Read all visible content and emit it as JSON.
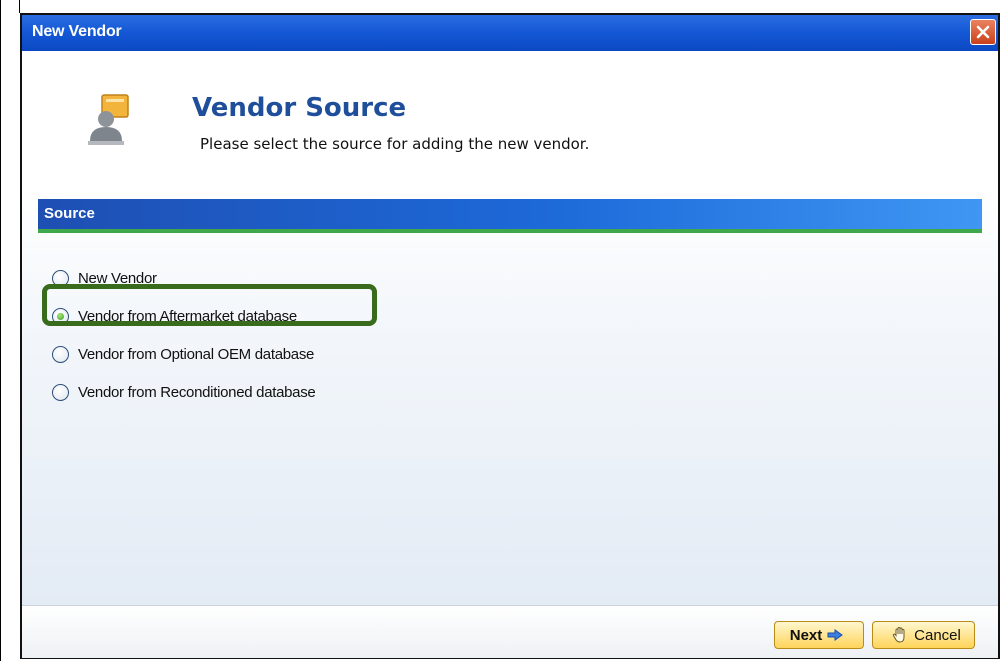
{
  "window": {
    "title": "New Vendor",
    "close_icon": "close-icon"
  },
  "header": {
    "title": "Vendor Source",
    "subtitle": "Please select the source for adding the new vendor.",
    "icon": "vendor-card-icon"
  },
  "section": {
    "label": "Source"
  },
  "options": [
    {
      "label": "New Vendor",
      "checked": false
    },
    {
      "label": "Vendor from Aftermarket database",
      "checked": true
    },
    {
      "label": "Vendor from Optional OEM database",
      "checked": false
    },
    {
      "label": "Vendor from Reconditioned database",
      "checked": false
    }
  ],
  "footer": {
    "next_label": "Next",
    "next_icon": "arrow-right-icon",
    "cancel_label": "Cancel",
    "cancel_icon": "hand-icon"
  },
  "colors": {
    "titlebar": "#1559d6",
    "header_title": "#1f4e9a",
    "section_bar": "#1d6ad9",
    "section_underline": "#3ea84a",
    "highlight": "#396b1c",
    "button": "#ffd45a"
  }
}
